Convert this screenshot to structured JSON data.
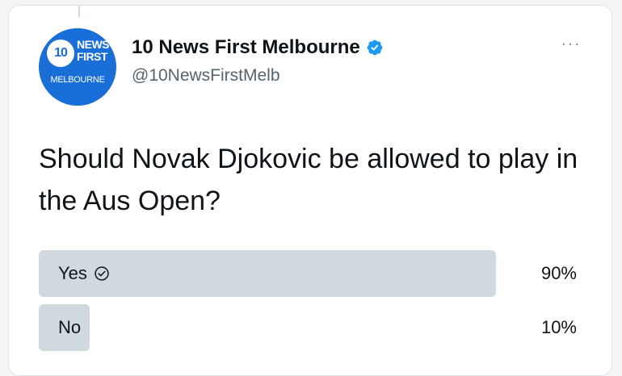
{
  "account": {
    "display_name": "10 News First Melbourne",
    "handle": "@10NewsFirstMelb",
    "verified": true,
    "avatar": {
      "badge_number": "10",
      "brand": "NEWS\nFIRST",
      "city": "MELBOURNE"
    }
  },
  "more_menu": {
    "label": "···",
    "icon": "more-horizontal-icon"
  },
  "tweet": {
    "text": "Should Novak Djokovic be allowed to play in the Aus Open?"
  },
  "poll": {
    "options": [
      {
        "label": "Yes",
        "percent_label": "90%",
        "percent": 90,
        "winner": true
      },
      {
        "label": "No",
        "percent_label": "10%",
        "percent": 10,
        "winner": false
      }
    ]
  },
  "colors": {
    "brand_blue": "#1a6ed8",
    "verified_blue": "#1d9bf0",
    "poll_fill": "#cfd9de",
    "text": "#0f1419",
    "secondary_text": "#536471"
  }
}
